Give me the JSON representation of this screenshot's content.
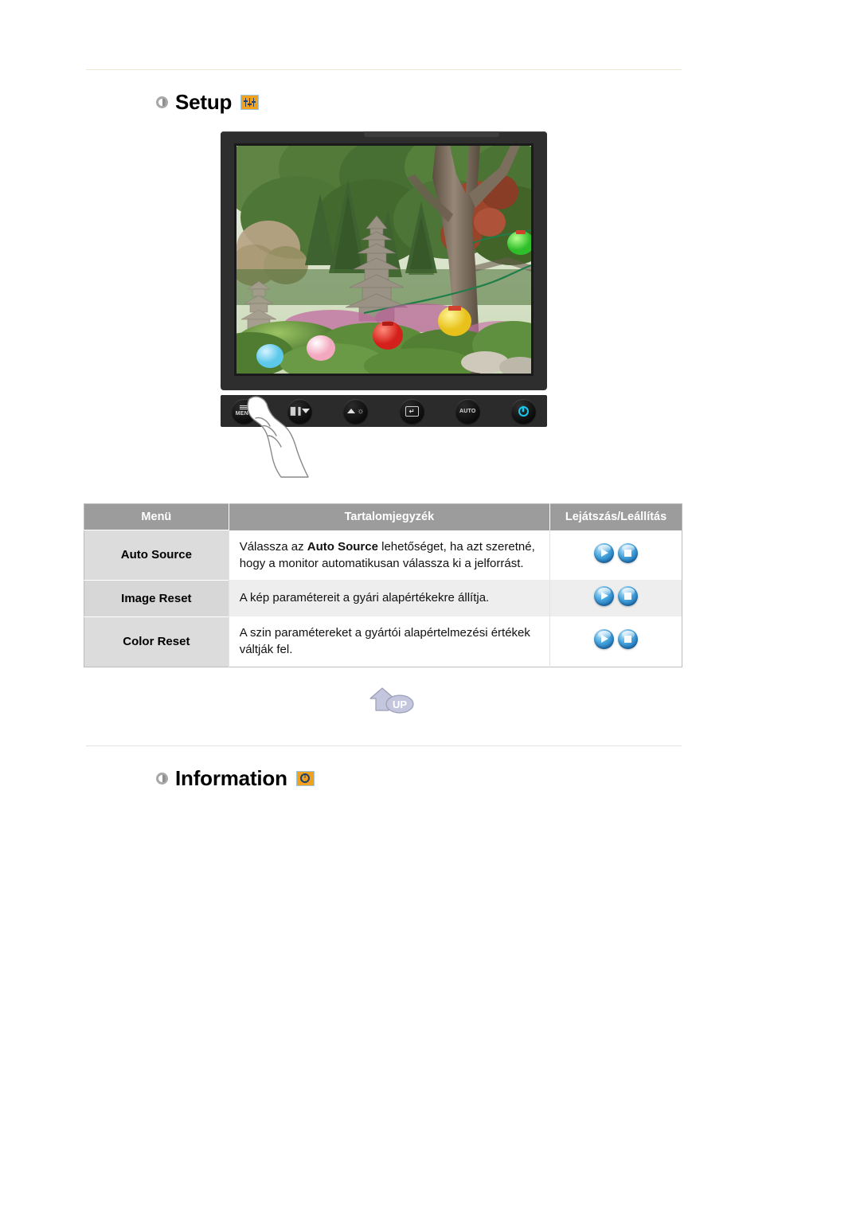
{
  "sections": {
    "setup": {
      "bullet": "bullet-circle-icon",
      "title": "Setup",
      "icon": "sliders-icon"
    },
    "information": {
      "bullet": "bullet-circle-icon",
      "title": "Information",
      "icon": "clock-icon"
    }
  },
  "monitor": {
    "screen_alt": "garden-photo-with-pagoda-and-lanterns",
    "buttons": [
      {
        "name": "menu-button",
        "label": "MENU"
      },
      {
        "name": "down-button",
        "label": ""
      },
      {
        "name": "brightness-up-button",
        "label": ""
      },
      {
        "name": "enter-button",
        "label": ""
      },
      {
        "name": "auto-button",
        "label": "AUTO"
      },
      {
        "name": "power-button",
        "label": ""
      }
    ],
    "pointer": "hand-pointer-illustration"
  },
  "table": {
    "headers": {
      "menu": "Menü",
      "contents": "Tartalomjegyzék",
      "playstop": "Lejátszás/Leállítás"
    },
    "rows": [
      {
        "menu": "Auto Source",
        "desc_before": "Válassza az ",
        "desc_bold": "Auto Source",
        "desc_after": " lehetőséget, ha azt szeretné, hogy a monitor automatikusan válassza ki a jelforrást.",
        "play": "play-icon",
        "stop": "stop-icon"
      },
      {
        "menu": "Image Reset",
        "desc_before": "A kép paramétereit a gyári alapértékekre állítja.",
        "desc_bold": "",
        "desc_after": "",
        "play": "play-icon",
        "stop": "stop-icon"
      },
      {
        "menu": "Color Reset",
        "desc_before": "A szin paramétereket a gyártói alapértelmezési értékek váltják fel.",
        "desc_bold": "",
        "desc_after": "",
        "play": "play-icon",
        "stop": "stop-icon"
      }
    ]
  },
  "up_button": {
    "label": "UP"
  },
  "colors": {
    "header_gray": "#9c9c9c",
    "menu_cell_gray": "#dcdcdc",
    "accent_orange": "#f0a21e",
    "button_blue": "#2f8fd0",
    "power_cyan": "#18c8f0",
    "rule_cream": "#ece7d4",
    "rule_gray": "#e3e3e3"
  }
}
